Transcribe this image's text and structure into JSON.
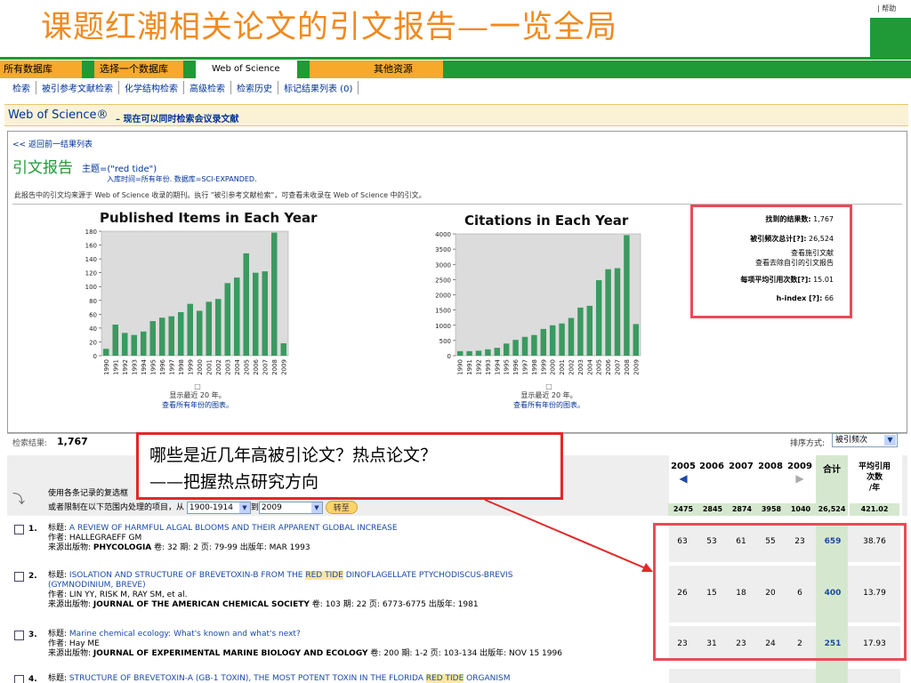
{
  "slide": {
    "title": "课题红潮相关论文的引文报告—一览全局",
    "help_label": "| 帮助"
  },
  "tabs": [
    {
      "label": "所有数据库"
    },
    {
      "label": "选择一个数据库"
    },
    {
      "label": "Web of Science"
    },
    {
      "label": "其他资源"
    }
  ],
  "subnav": [
    "检索",
    "被引参考文献检索",
    "化学结构检索",
    "高级检索",
    "检索历史",
    "标记结果列表 (0)"
  ],
  "wos": {
    "brand": "Web of Science®",
    "tagline": "– 现在可以同时检索会议录文献"
  },
  "report": {
    "back_link": "<< 返回前一结果列表",
    "heading": "引文报告",
    "topic": "主题=(\"red tide\")",
    "db_info": "入库时间=所有年份. 数据库=SCI-EXPANDED.",
    "note": "此报告中的引文均来源于 Web of Science 收录的期刊。执行 \"被引参考文献检索\"，可查看未收录在 Web of Science 中的引文。"
  },
  "chart_data": [
    {
      "type": "bar",
      "title": "Published Items in Each Year",
      "categories": [
        "1990",
        "1991",
        "1992",
        "1993",
        "1994",
        "1995",
        "1996",
        "1997",
        "1998",
        "1999",
        "2000",
        "2001",
        "2002",
        "2003",
        "2004",
        "2005",
        "2006",
        "2007",
        "2008",
        "2009"
      ],
      "values": [
        10,
        45,
        33,
        30,
        35,
        50,
        55,
        57,
        63,
        75,
        65,
        78,
        82,
        105,
        113,
        148,
        120,
        122,
        178,
        18
      ],
      "ylim": [
        0,
        180
      ],
      "yticks": [
        0,
        20,
        40,
        60,
        80,
        100,
        120,
        140,
        160,
        180
      ],
      "color": "#3a9a60",
      "grid": false,
      "footer": [
        "显示最近 20 年。",
        "查看所有年份的图表。"
      ]
    },
    {
      "type": "bar",
      "title": "Citations in Each Year",
      "categories": [
        "1990",
        "1991",
        "1992",
        "1993",
        "1994",
        "1995",
        "1996",
        "1997",
        "1998",
        "1999",
        "2000",
        "2001",
        "2002",
        "2003",
        "2004",
        "2005",
        "2006",
        "2007",
        "2008",
        "2009"
      ],
      "values": [
        150,
        150,
        165,
        210,
        260,
        400,
        520,
        620,
        680,
        880,
        1000,
        1060,
        1240,
        1580,
        1640,
        2480,
        2840,
        2874,
        3958,
        1040
      ],
      "ylim": [
        0,
        4000
      ],
      "yticks": [
        0,
        500,
        1000,
        1500,
        2000,
        2500,
        3000,
        3500,
        4000
      ],
      "color": "#3a9a60",
      "grid": false,
      "footer": [
        "显示最近 20 年。",
        "查看所有年份的图表。"
      ]
    }
  ],
  "stats": {
    "found_label": "找到的结果数:",
    "found_value": "1,767",
    "cited_label": "被引频次总计[?]:",
    "cited_value": "26,524",
    "link1": "查看施引文献",
    "link2": "查看去除自引的引文报告",
    "avg_label": "每项平均引用次数[?]:",
    "avg_value": "15.01",
    "h_label": "h-index [?]:",
    "h_value": "66"
  },
  "results": {
    "label": "检索结果:",
    "count": "1,767",
    "sort_label": "排序方式:",
    "sort_value": "被引频次",
    "select_hint": "使用各条记录的复选框",
    "range_hint": "或者限制在以下范围内处理的项目，从",
    "range_from": "1900-1914",
    "range_to_label": "到",
    "range_to": "2009",
    "go_label": "转至"
  },
  "table": {
    "years": [
      "2005",
      "2006",
      "2007",
      "2008",
      "2009"
    ],
    "total_label": "合计",
    "avg_label_lines": [
      "平均引用",
      "次数",
      "/年"
    ],
    "totals": [
      "2475",
      "2845",
      "2874",
      "3958",
      "1040",
      "26,524",
      "421.02"
    ]
  },
  "records": [
    {
      "num": "1.",
      "title_prefix": "标题:",
      "title": "A REVIEW OF HARMFUL ALGAL BLOOMS AND THEIR APPARENT GLOBAL INCREASE",
      "author_prefix": "作者:",
      "authors": "HALLEGRAEFF GM",
      "source_prefix": "来源出版物:",
      "source": "PHYCOLOGIA",
      "details": "卷: 32  期: 2  页: 79-99  出版年: MAR 1993",
      "counts": [
        "63",
        "53",
        "61",
        "55",
        "23",
        "659",
        "38.76"
      ]
    },
    {
      "num": "2.",
      "title_prefix": "标题:",
      "title_a": "ISOLATION AND STRUCTURE OF BREVETOXIN-B FROM THE ",
      "title_hl": "RED TIDE",
      "title_b": " DINOFLAGELLATE PTYCHODISCUS-BREVIS",
      "title_c": "(GYMNODINIUM, BREVE)",
      "author_prefix": "作者:",
      "authors": "LIN YY, RISK M, RAY SM, et al.",
      "source_prefix": "来源出版物:",
      "source": "JOURNAL OF THE AMERICAN CHEMICAL SOCIETY",
      "details": "卷: 103  期: 22  页: 6773-6775  出版年: 1981",
      "counts": [
        "26",
        "15",
        "18",
        "20",
        "6",
        "400",
        "13.79"
      ]
    },
    {
      "num": "3.",
      "title_prefix": "标题:",
      "title": "Marine chemical ecology: What's known and what's next?",
      "author_prefix": "作者:",
      "authors": "Hay ME",
      "source_prefix": "来源出版物:",
      "source": "JOURNAL OF EXPERIMENTAL MARINE BIOLOGY AND ECOLOGY",
      "details": "卷: 200  期: 1-2  页: 103-134  出版年: NOV 15 1996",
      "counts": [
        "23",
        "31",
        "23",
        "24",
        "2",
        "251",
        "17.93"
      ]
    },
    {
      "num": "4.",
      "title_prefix": "标题:",
      "title_a": "STRUCTURE OF BREVETOXIN-A (GB-1 TOXIN), THE MOST POTENT TOXIN IN THE FLORIDA ",
      "title_hl": "RED TIDE",
      "title_b": " ORGANISM"
    }
  ],
  "callout": {
    "line1": "哪些是近几年高被引论文？热点论文？",
    "line2": "——把握热点研究方向"
  }
}
